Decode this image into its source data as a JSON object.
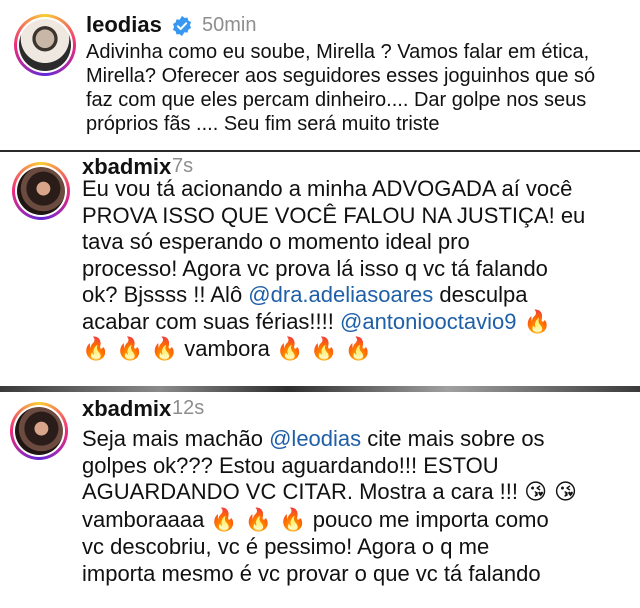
{
  "comments": [
    {
      "username": "leodias",
      "verified": true,
      "time": "50min",
      "lines": [
        [
          {
            "t": "Adivinha como eu soube, Mirella ? Vamos falar em ética,"
          }
        ],
        [
          {
            "t": "Mirella? Oferecer aos seguidores esses joguinhos que só"
          }
        ],
        [
          {
            "t": "faz com que eles percam dinheiro.... Dar golpe nos seus"
          }
        ],
        [
          {
            "t": "próprios fãs .... Seu fim será muito triste"
          }
        ]
      ]
    },
    {
      "username": "xbadmix",
      "verified": false,
      "time": "7s",
      "lines": [
        [
          {
            "t": "Eu vou tá acionando a minha ADVOGADA aí você"
          }
        ],
        [
          {
            "t": "PROVA ISSO QUE VOCÊ FALOU NA JUSTIÇA! eu"
          }
        ],
        [
          {
            "t": "tava só esperando o momento ideal pro"
          }
        ],
        [
          {
            "t": "processo! Agora vc prova lá isso q vc tá falando"
          }
        ],
        [
          {
            "t": "ok? Bjssss !! Alô "
          },
          {
            "t": "@dra.adeliasoares",
            "m": true
          },
          {
            "t": " desculpa"
          }
        ],
        [
          {
            "t": "acabar com suas férias!!!! "
          },
          {
            "t": "@antoniooctavio9",
            "m": true
          },
          {
            "t": " 🔥",
            "e": true
          }
        ],
        [
          {
            "t": "🔥 🔥 🔥",
            "e": true
          },
          {
            "t": " vambora "
          },
          {
            "t": "🔥 🔥 🔥",
            "e": true
          }
        ]
      ]
    },
    {
      "username": "xbadmix",
      "verified": false,
      "time": "12s",
      "lines": [
        [
          {
            "t": "Seja mais machão "
          },
          {
            "t": "@leodias",
            "m": true
          },
          {
            "t": " cite mais sobre os"
          }
        ],
        [
          {
            "t": "golpes ok??? Estou aguardando!!! ESTOU"
          }
        ],
        [
          {
            "t": "AGUARDANDO VC CITAR. Mostra a cara !!! "
          },
          {
            "t": "😘 😘",
            "e": true
          }
        ],
        [
          {
            "t": "vamboraaaa "
          },
          {
            "t": "🔥 🔥 🔥",
            "e": true
          },
          {
            "t": " pouco me importa como"
          }
        ],
        [
          {
            "t": "vc descobriu, vc é pessimo! Agora o q me"
          }
        ],
        [
          {
            "t": "importa mesmo é vc provar o que vc tá falando"
          }
        ]
      ]
    }
  ]
}
